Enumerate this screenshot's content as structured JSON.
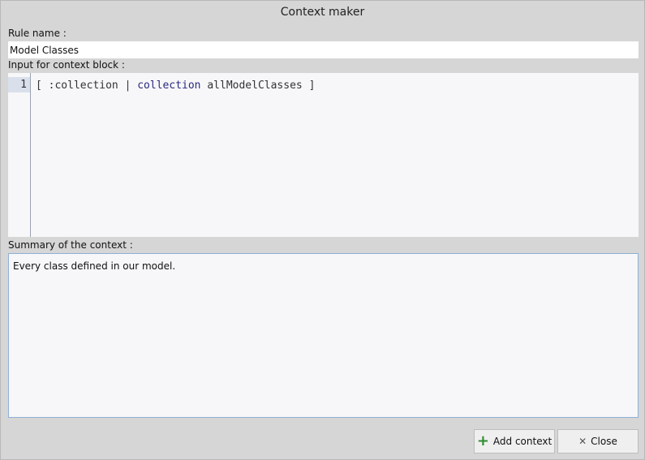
{
  "window": {
    "title": "Context maker"
  },
  "rule_name": {
    "label": "Rule name :",
    "value": "Model Classes"
  },
  "context_input": {
    "label": "Input for context block :",
    "line_number": "1",
    "code_parts": [
      "[ :collection | ",
      "collection",
      " allModelClasses ]"
    ]
  },
  "summary": {
    "label": "Summary of the context :",
    "text": "Every class defined in our model."
  },
  "buttons": {
    "add_context": "Add context",
    "close": "Close"
  }
}
